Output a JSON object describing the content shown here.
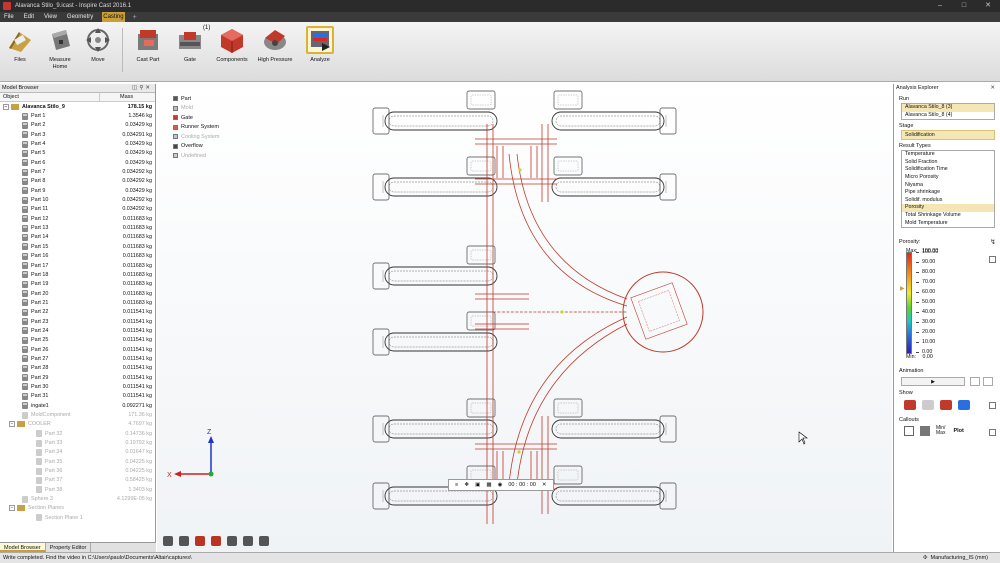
{
  "window": {
    "title": "Alavanca Stilo_9.icast - Inspire Cast 2016.1"
  },
  "menu": {
    "items": [
      "File",
      "Edit",
      "View",
      "Geometry",
      "Casting"
    ],
    "active": "Casting"
  },
  "ribbon": {
    "files": "Files",
    "measure_home": "Measure\nHome",
    "move": "Move",
    "cast_part": "Cast Part",
    "gate": "Gate",
    "gate_badge": "(1)",
    "components": "Components",
    "high_pressure": "High Pressure",
    "analyze": "Analyze"
  },
  "model_browser": {
    "title": "Model Browser",
    "col_object": "Object",
    "col_mass": "Mass",
    "rows": [
      {
        "name": "Alavanca Stilo_9",
        "mass": "178.15 kg",
        "kind": "root"
      },
      {
        "name": "Part 1",
        "mass": "1.3546 kg"
      },
      {
        "name": "Part 2",
        "mass": "0.03429 kg"
      },
      {
        "name": "Part 3",
        "mass": "0.034291 kg"
      },
      {
        "name": "Part 4",
        "mass": "0.03429 kg"
      },
      {
        "name": "Part 5",
        "mass": "0.03429 kg"
      },
      {
        "name": "Part 6",
        "mass": "0.03429 kg"
      },
      {
        "name": "Part 7",
        "mass": "0.034292 kg"
      },
      {
        "name": "Part 8",
        "mass": "0.034292 kg"
      },
      {
        "name": "Part 9",
        "mass": "0.03429 kg"
      },
      {
        "name": "Part 10",
        "mass": "0.034292 kg"
      },
      {
        "name": "Part 11",
        "mass": "0.034292 kg"
      },
      {
        "name": "Part 12",
        "mass": "0.011683 kg"
      },
      {
        "name": "Part 13",
        "mass": "0.011683 kg"
      },
      {
        "name": "Part 14",
        "mass": "0.011683 kg"
      },
      {
        "name": "Part 15",
        "mass": "0.011683 kg"
      },
      {
        "name": "Part 16",
        "mass": "0.011683 kg"
      },
      {
        "name": "Part 17",
        "mass": "0.011683 kg"
      },
      {
        "name": "Part 18",
        "mass": "0.011683 kg"
      },
      {
        "name": "Part 19",
        "mass": "0.011683 kg"
      },
      {
        "name": "Part 20",
        "mass": "0.011683 kg"
      },
      {
        "name": "Part 21",
        "mass": "0.011683 kg"
      },
      {
        "name": "Part 22",
        "mass": "0.011541 kg"
      },
      {
        "name": "Part 23",
        "mass": "0.011541 kg"
      },
      {
        "name": "Part 24",
        "mass": "0.011541 kg"
      },
      {
        "name": "Part 25",
        "mass": "0.011541 kg"
      },
      {
        "name": "Part 26",
        "mass": "0.011541 kg"
      },
      {
        "name": "Part 27",
        "mass": "0.011541 kg"
      },
      {
        "name": "Part 28",
        "mass": "0.011541 kg"
      },
      {
        "name": "Part 29",
        "mass": "0.011541 kg"
      },
      {
        "name": "Part 30",
        "mass": "0.011541 kg"
      },
      {
        "name": "Part 31",
        "mass": "0.011541 kg"
      },
      {
        "name": "ingate1",
        "mass": "0.092271 kg"
      },
      {
        "name": "MoldComponent",
        "mass": "171.36 kg",
        "grey": true
      },
      {
        "name": "COOLER",
        "mass": "4.7697 kg",
        "grey": true,
        "kind": "folder"
      },
      {
        "name": "Part 32",
        "mass": "0.14736 kg",
        "grey": true,
        "indent": true
      },
      {
        "name": "Part 33",
        "mass": "0.19792 kg",
        "grey": true,
        "indent": true
      },
      {
        "name": "Part 34",
        "mass": "0.01647 kg",
        "grey": true,
        "indent": true
      },
      {
        "name": "Part 35",
        "mass": "0.04225 kg",
        "grey": true,
        "indent": true
      },
      {
        "name": "Part 36",
        "mass": "0.04225 kg",
        "grey": true,
        "indent": true
      },
      {
        "name": "Part 37",
        "mass": "0.58425 kg",
        "grey": true,
        "indent": true
      },
      {
        "name": "Part 38",
        "mass": "1.3403 kg",
        "grey": true,
        "indent": true
      },
      {
        "name": "Sphere 3",
        "mass": "4.1299E-05 kg",
        "grey": true
      },
      {
        "name": "Section Planes",
        "mass": "",
        "grey": true,
        "kind": "folder"
      },
      {
        "name": "Section Plane 1",
        "mass": "",
        "grey": true,
        "indent": true
      }
    ],
    "tabs": [
      "Model Browser",
      "Property Editor"
    ]
  },
  "legend": [
    {
      "label": "Part",
      "color": "#555555"
    },
    {
      "label": "Mold",
      "color": "#bbbbbb",
      "dim": true
    },
    {
      "label": "Gate",
      "color": "#c0392b"
    },
    {
      "label": "Runner System",
      "color": "#d9534f"
    },
    {
      "label": "Cooling System",
      "color": "#b8c8d8",
      "dim": true
    },
    {
      "label": "Overflow",
      "color": "#444444"
    },
    {
      "label": "Undefined",
      "color": "#cccccc",
      "dim": true
    }
  ],
  "animbar": {
    "time": "00 : 00 : 00"
  },
  "analysis": {
    "title": "Analysis Explorer",
    "run_label": "Run",
    "runs": [
      "Alavanca Stilo_8 (3)",
      "Alavanca Stilo_8 (4)"
    ],
    "stage_label": "Stage",
    "stage": "Solidification",
    "result_label": "Result Types",
    "results": [
      "Temperature",
      "Solid Fraction",
      "Solidification Time",
      "Micro Porosity",
      "Niyama",
      "Pipe shrinkage",
      "Solidif. modulus",
      "Porosity",
      "Total Shrinkage Volume",
      "Mold Temperature"
    ],
    "selected_result": "Porosity",
    "scale_label": "Porosity:",
    "max_label": "Max:",
    "max_value": "100.00",
    "min_label": "Min:",
    "min_value": "0.00",
    "scale_values": [
      "100.00",
      "90.00",
      "80.00",
      "70.00",
      "60.00",
      "50.00",
      "40.00",
      "30.00",
      "20.00",
      "10.00",
      "0.00"
    ],
    "animation_label": "Animation",
    "show_label": "Show",
    "callouts_label": "Callouts",
    "callout_minmax": "Min/\nMax",
    "callout_plot": "Plot"
  },
  "status": {
    "message": "Write completed. Find the video in C:\\Users\\paulo\\Documents\\Altair\\captures\\",
    "units": "Manufacturing_IS (mm)"
  },
  "colors": {
    "accent": "#c8a036",
    "runner": "#c0392b"
  }
}
